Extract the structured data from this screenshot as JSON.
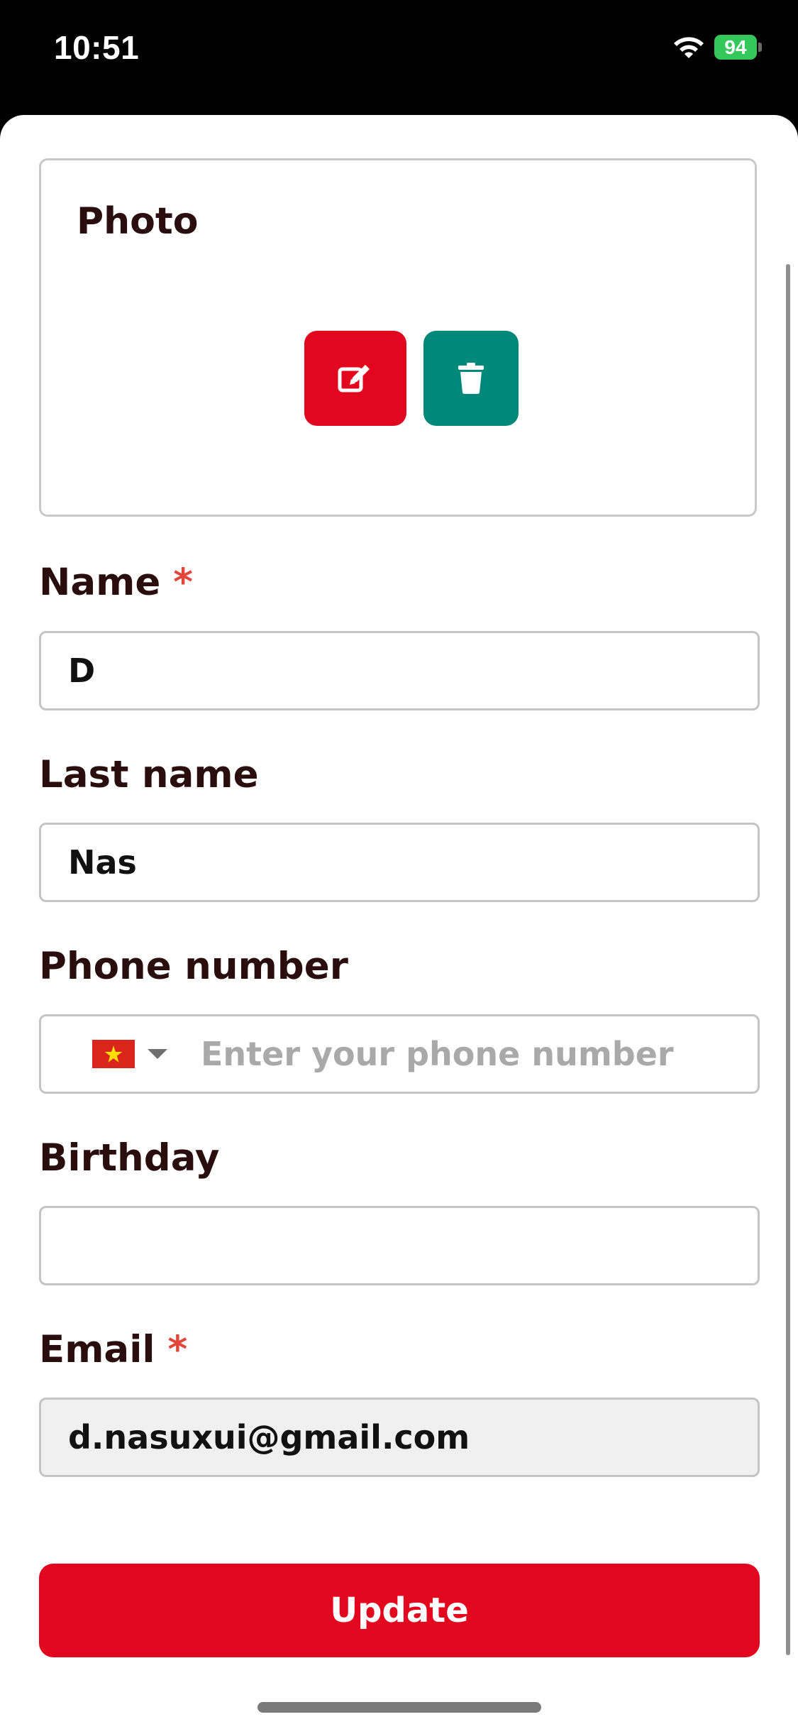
{
  "status_bar": {
    "time": "10:51",
    "battery_level": "94",
    "battery_color": "#34c759",
    "icons": [
      "wifi-icon",
      "battery-charging-icon"
    ]
  },
  "photo": {
    "title": "Photo",
    "edit_icon": "edit-icon",
    "delete_icon": "trash-icon"
  },
  "form": {
    "name": {
      "label": "Name",
      "required_mark": "*",
      "value": "D"
    },
    "last_name": {
      "label": "Last name",
      "value": "Nas"
    },
    "phone": {
      "label": "Phone number",
      "country_flag": "vietnam-flag-icon",
      "placeholder": "Enter your phone number",
      "value": ""
    },
    "birthday": {
      "label": "Birthday",
      "value": ""
    },
    "email": {
      "label": "Email",
      "required_mark": "*",
      "value": "d.nasuxui@gmail.com"
    }
  },
  "actions": {
    "update_label": "Update"
  },
  "colors": {
    "primary_red": "#e2061f",
    "teal": "#00897b",
    "label_text": "#2a0d0d",
    "required": "#e0463a"
  }
}
